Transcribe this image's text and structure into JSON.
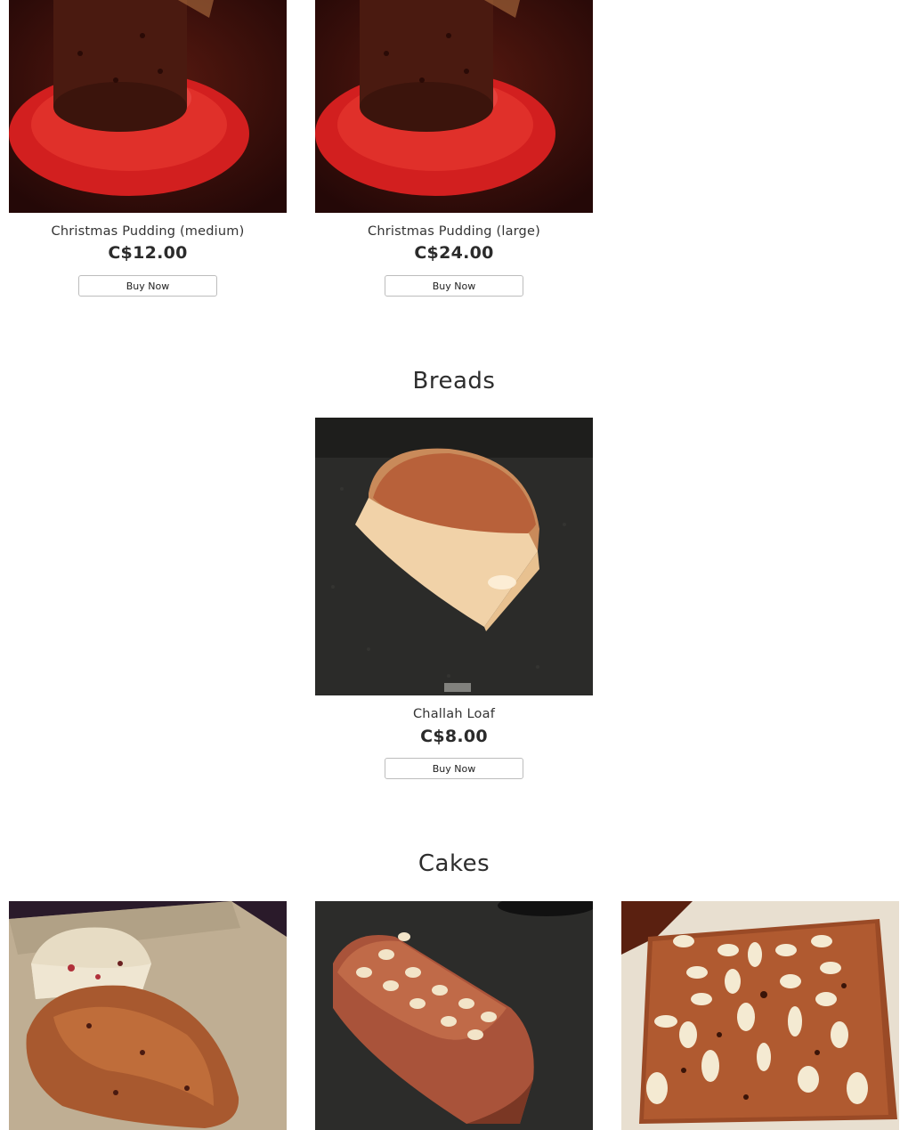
{
  "sections": {
    "breads": {
      "title": "Breads"
    },
    "cakes": {
      "title": "Cakes"
    }
  },
  "products": {
    "pudding_medium": {
      "name": "Christmas Pudding (medium)",
      "price": "C$12.00",
      "cta": "Buy Now"
    },
    "pudding_large": {
      "name": "Christmas Pudding (large)",
      "price": "C$24.00",
      "cta": "Buy Now"
    },
    "challah": {
      "name": "Challah Loaf",
      "price": "C$8.00",
      "cta": "Buy Now"
    }
  },
  "images": {
    "pudding_medium": "christmas-pudding-photo",
    "pudding_large": "christmas-pudding-photo",
    "challah": "challah-loaf-photo",
    "cake_1": "stollen-photo",
    "cake_2": "almond-loaf-cake-photo",
    "cake_3": "almond-fruit-cake-photo"
  }
}
